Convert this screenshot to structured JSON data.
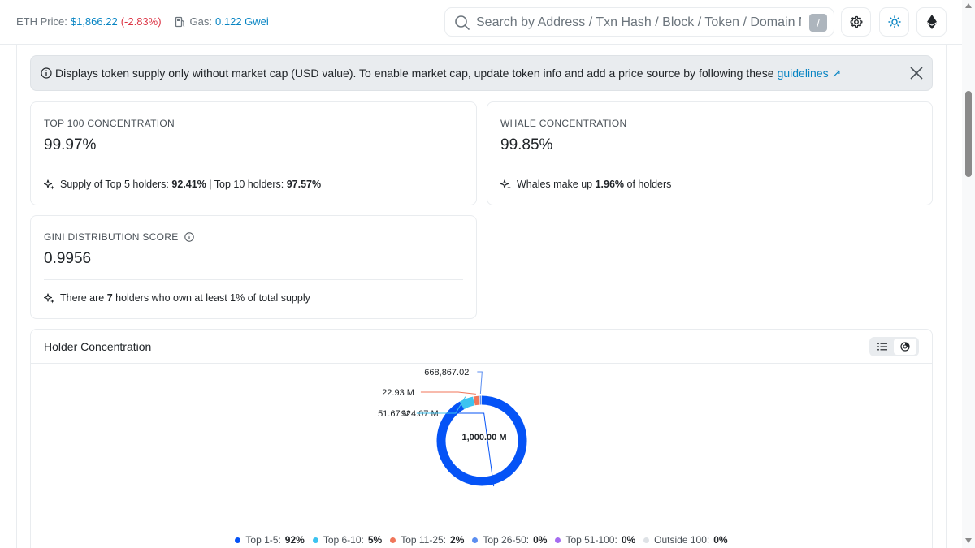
{
  "header": {
    "eth_price_label": "ETH Price:",
    "eth_price_value": "$1,866.22",
    "eth_price_change": "(-2.83%)",
    "gas_label": "Gas:",
    "gas_value": "0.122 Gwei",
    "search_placeholder": "Search by Address / Txn Hash / Block / Token / Domain Name",
    "search_shortcut": "/"
  },
  "alert": {
    "text": "Displays token supply only without market cap (USD value). To enable market cap, update token info and add a price source by following these",
    "link_label": "guidelines ↗"
  },
  "cards": {
    "top100": {
      "label": "TOP 100 CONCENTRATION",
      "value": "99.97%",
      "foot_prefix": "Supply of Top 5 holders:",
      "foot_top5": "92.41%",
      "foot_mid": "| Top 10 holders:",
      "foot_top10": "97.57%"
    },
    "whale": {
      "label": "WHALE CONCENTRATION",
      "value": "99.85%",
      "foot_prefix": "Whales make up",
      "foot_pct": "1.96%",
      "foot_suffix": "of holders"
    },
    "gini": {
      "label": "GINI DISTRIBUTION SCORE",
      "value": "0.9956",
      "foot_prefix": "There are",
      "foot_count": "7",
      "foot_suffix": "holders who own at least 1% of total supply"
    }
  },
  "chart_section": {
    "title": "Holder Concentration"
  },
  "chart_data": {
    "type": "pie",
    "center_label": "1,000.00 M",
    "slices": [
      {
        "name": "Top 1-5",
        "value": 924.07,
        "label": "924.07 M",
        "color": "#0553f6"
      },
      {
        "name": "Top 6-10",
        "value": 51.67,
        "label": "51.67 M",
        "color": "#3cc3f0"
      },
      {
        "name": "Top 11-25",
        "value": 22.93,
        "label": "22.93 M",
        "color": "#f0765a"
      },
      {
        "name": "Top 26-50",
        "value": 0.66886702,
        "label": "668,867.02",
        "color": "#5b8ef0"
      },
      {
        "name": "Top 51-100",
        "value": 0,
        "label": "",
        "color": "#a56cf0"
      },
      {
        "name": "Outside 100",
        "value": 0,
        "label": "",
        "color": "#dee2e6"
      }
    ],
    "legend": [
      {
        "name": "Top 1-5:",
        "pct": "92%",
        "color": "#0553f6"
      },
      {
        "name": "Top 6-10:",
        "pct": "5%",
        "color": "#3cc3f0"
      },
      {
        "name": "Top 11-25:",
        "pct": "2%",
        "color": "#f0765a"
      },
      {
        "name": "Top 26-50:",
        "pct": "0%",
        "color": "#5b8ef0"
      },
      {
        "name": "Top 51-100:",
        "pct": "0%",
        "color": "#a56cf0"
      },
      {
        "name": "Outside 100:",
        "pct": "0%",
        "color": "#dee2e6"
      }
    ]
  }
}
